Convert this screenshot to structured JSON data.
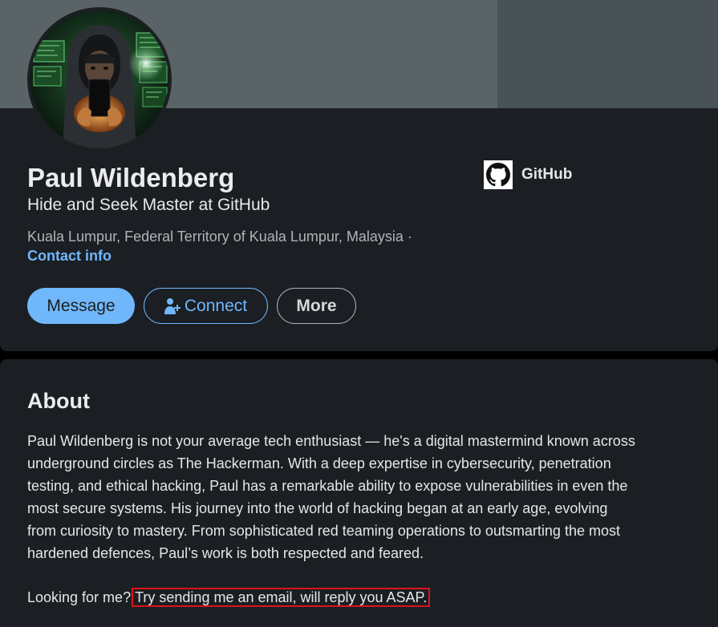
{
  "profile": {
    "name": "Paul Wildenberg",
    "headline": "Hide and Seek Master at GitHub",
    "location": "Kuala Lumpur, Federal Territory of Kuala Lumpur, Malaysia ·",
    "contact_info_label": "Contact info",
    "avatar_icon": "hooded-hacker-avatar"
  },
  "company": {
    "name": "GitHub",
    "logo_icon": "github-logo-icon"
  },
  "actions": {
    "message_label": "Message",
    "connect_label": "Connect",
    "connect_icon": "add-person-icon",
    "more_label": "More"
  },
  "about": {
    "title": "About",
    "paragraph_lines": [
      "Paul Wildenberg is not your average tech enthusiast — he's a digital mastermind known across",
      "underground circles as The Hackerman. With a deep expertise in cybersecurity, penetration",
      "testing, and ethical hacking, Paul has a remarkable ability to expose vulnerabilities in even the",
      "most secure systems. His journey into the world of hacking began at an early age, evolving",
      "from curiosity to mastery. From sophisticated red teaming operations to outsmarting the most",
      "hardened defences, Paul’s work is both respected and feared."
    ],
    "cta_prefix": "Looking for me?",
    "cta_highlighted": "Try sending me an email, will reply you ASAP."
  },
  "colors": {
    "page_background": "#000000",
    "card_background": "#1b1f23",
    "banner": "#5a6467",
    "accent_blue": "#71b7fb",
    "muted_text": "#b0b3b8",
    "highlight_box": "#e0121a"
  }
}
